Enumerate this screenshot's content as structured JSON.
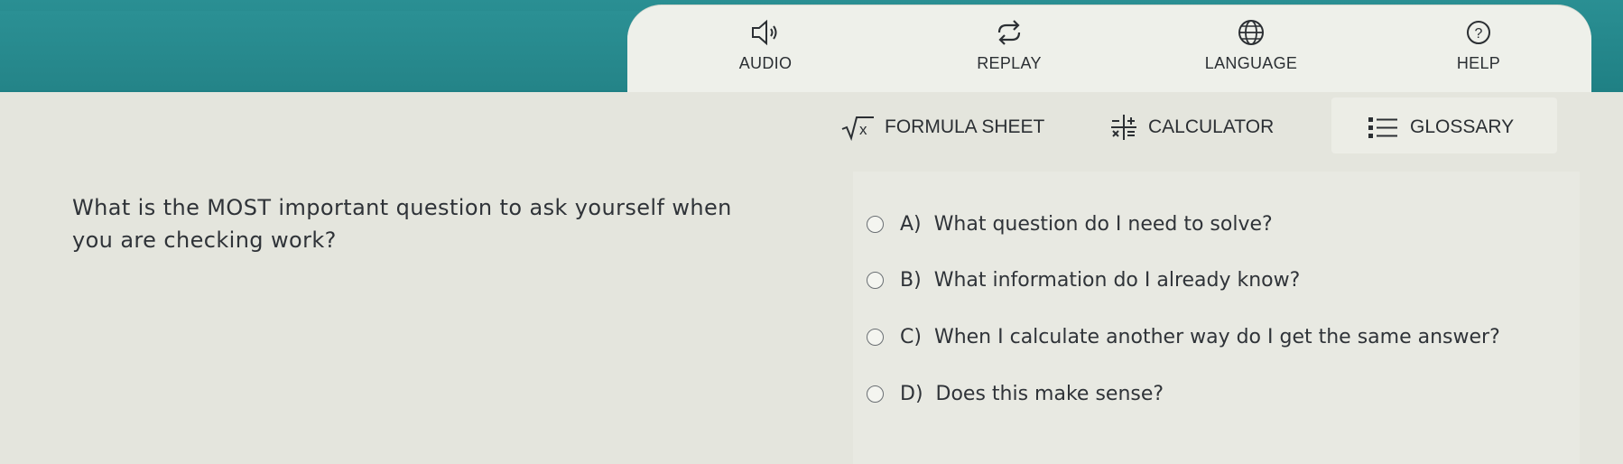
{
  "toolbar": {
    "audio": {
      "label": "AUDIO",
      "icon": "speaker-icon"
    },
    "replay": {
      "label": "REPLAY",
      "icon": "replay-icon"
    },
    "language": {
      "label": "LANGUAGE",
      "icon": "globe-icon"
    },
    "help": {
      "label": "HELP",
      "icon": "question-circle-icon"
    }
  },
  "tools": {
    "formula": {
      "label": "FORMULA SHEET",
      "icon": "sqrt-x-icon"
    },
    "calculator": {
      "label": "CALCULATOR",
      "icon": "calculator-operators-icon"
    },
    "glossary": {
      "label": "GLOSSARY",
      "icon": "list-icon"
    }
  },
  "question": {
    "line1": "What is the MOST important question to ask yourself when",
    "line2": "you are checking work?"
  },
  "answers": [
    {
      "letter": "A)",
      "text": "What question do I need to solve?"
    },
    {
      "letter": "B)",
      "text": "What information do I already know?"
    },
    {
      "letter": "C)",
      "text": "When I calculate another way do I get the same answer?"
    },
    {
      "letter": "D)",
      "text": "Does this make sense?"
    }
  ],
  "colors": {
    "teal": "#2a8f93",
    "panel": "#eef0ea",
    "text": "#2b2f33"
  }
}
